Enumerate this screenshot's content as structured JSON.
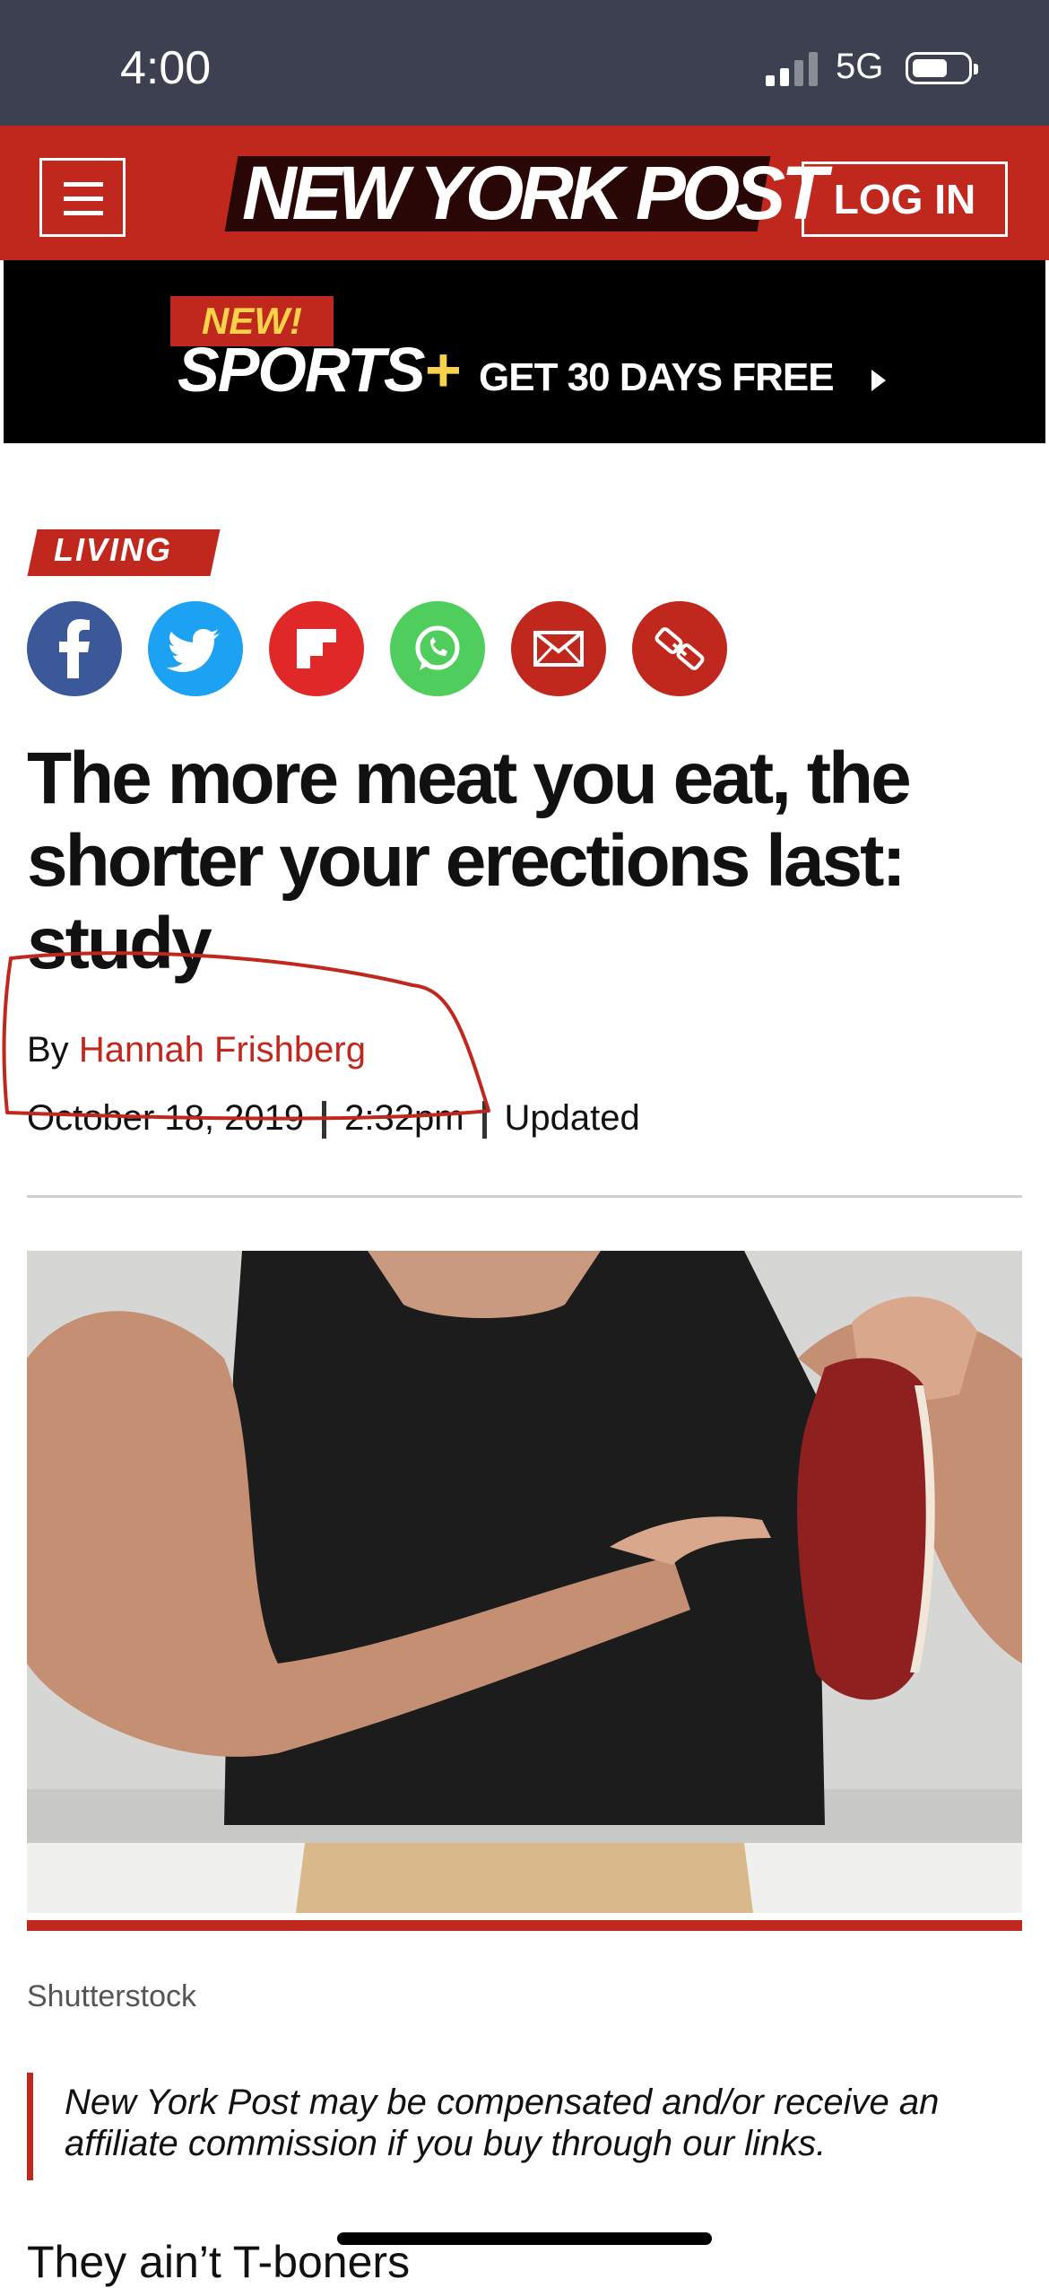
{
  "status_bar": {
    "time": "4:00",
    "network": "5G",
    "signal_icon": "cellular-signal-icon",
    "battery_icon": "battery-icon"
  },
  "header": {
    "logo": "NEW YORK POST",
    "login_label": "LOG IN",
    "menu_icon": "hamburger-menu-icon",
    "brand_color": "#c0281e"
  },
  "promo": {
    "badge": "NEW!",
    "product": "SPORTS",
    "product_plus": "+",
    "cta": "GET 30 DAYS FREE",
    "cta_icon": "play-arrow-icon"
  },
  "article": {
    "category": "LIVING",
    "share_icons": [
      "facebook-icon",
      "twitter-icon",
      "flipboard-icon",
      "whatsapp-icon",
      "email-icon",
      "link-icon"
    ],
    "headline": "The more meat you eat, the shorter your erections last: study",
    "byline_prefix": "By",
    "author": "Hannah Frishberg",
    "date": "October 18, 2019",
    "time": "2:32pm",
    "updated_label": "Updated",
    "photo_credit": "Shutterstock",
    "disclaimer": "New York Post may be compensated and/or receive an affiliate commission if you buy through our links.",
    "body_start": "They ain’t T-boners"
  },
  "colors": {
    "status_bar": "#3d4050",
    "accent": "#c0281e",
    "facebook": "#3b5998",
    "twitter": "#1da1f2",
    "flipboard": "#e12828",
    "whatsapp": "#4fce5d",
    "email": "#c0281e",
    "link": "#c0281e"
  }
}
